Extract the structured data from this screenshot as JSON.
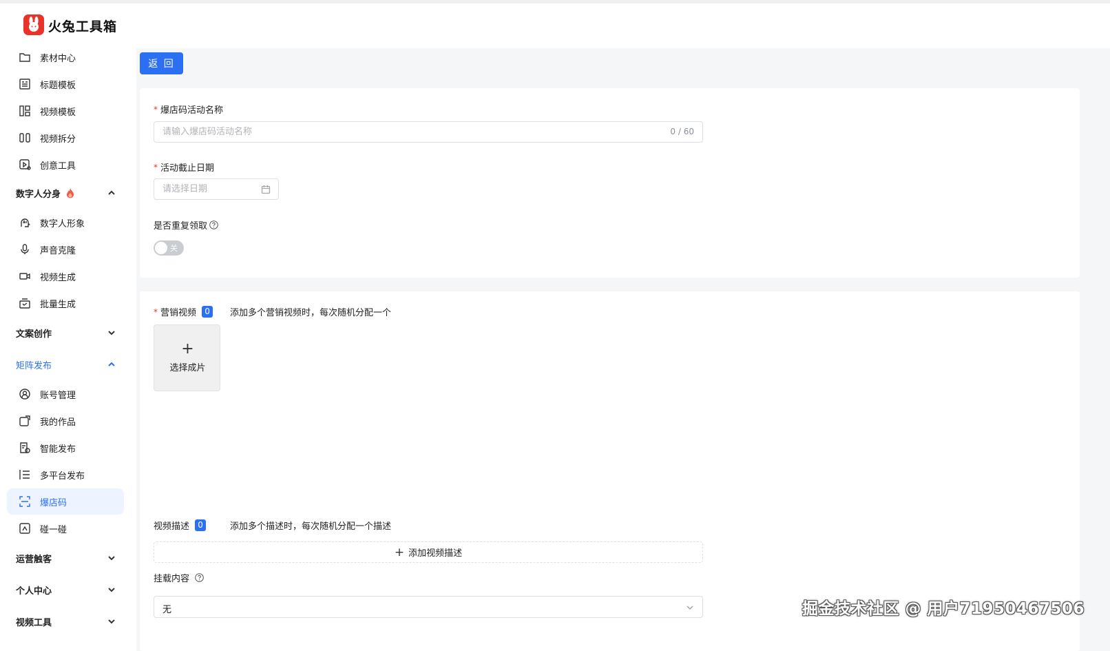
{
  "app": {
    "title": "火兔工具箱"
  },
  "sidebar": {
    "items_top": [
      {
        "label": "素材中心",
        "icon": "folder-icon"
      },
      {
        "label": "标题模板",
        "icon": "title-template-icon"
      },
      {
        "label": "视频模板",
        "icon": "video-template-icon"
      },
      {
        "label": "视频拆分",
        "icon": "video-split-icon"
      },
      {
        "label": "创意工具",
        "icon": "creative-tool-icon"
      }
    ],
    "group_digital": {
      "label": "数字人分身",
      "items": [
        {
          "label": "数字人形象",
          "icon": "digital-avatar-icon"
        },
        {
          "label": "声音克隆",
          "icon": "microphone-icon"
        },
        {
          "label": "视频生成",
          "icon": "video-camera-icon"
        },
        {
          "label": "批量生成",
          "icon": "batch-icon"
        }
      ]
    },
    "group_copywriting": {
      "label": "文案创作"
    },
    "group_matrix": {
      "label": "矩阵发布",
      "items": [
        {
          "label": "账号管理",
          "icon": "account-icon"
        },
        {
          "label": "我的作品",
          "icon": "works-icon"
        },
        {
          "label": "智能发布",
          "icon": "smart-publish-icon"
        },
        {
          "label": "多平台发布",
          "icon": "multi-platform-icon"
        },
        {
          "label": "爆店码",
          "icon": "scan-code-icon",
          "active": true
        },
        {
          "label": "碰一碰",
          "icon": "tap-icon"
        }
      ]
    },
    "group_ops": {
      "label": "运营触客"
    },
    "group_personal": {
      "label": "个人中心"
    },
    "group_video_tools": {
      "label": "视频工具"
    }
  },
  "toolbar": {
    "back_label": "返 回"
  },
  "form": {
    "activity_name": {
      "label": "爆店码活动名称",
      "placeholder": "请输入爆店码活动名称",
      "counter": "0 / 60",
      "value": ""
    },
    "deadline": {
      "label": "活动截止日期",
      "placeholder": "请选择日期"
    },
    "repeat": {
      "label": "是否重复领取",
      "toggle_label": "关",
      "on": false
    },
    "marketing_video": {
      "label": "营销视频",
      "count": "0",
      "hint": "添加多个营销视频时，每次随机分配一个",
      "upload_plus": "+",
      "upload_label": "选择成片"
    },
    "video_desc": {
      "label": "视频描述",
      "count": "0",
      "hint": "添加多个描述时，每次随机分配一个描述",
      "add_label": "添加视频描述"
    },
    "mount": {
      "label": "挂载内容",
      "value": "无"
    }
  },
  "watermark": "掘金技术社区 @ 用户71950467506",
  "colors": {
    "accent": "#2b6ff2",
    "required": "#e8332a",
    "bg": "#f5f6f8"
  }
}
